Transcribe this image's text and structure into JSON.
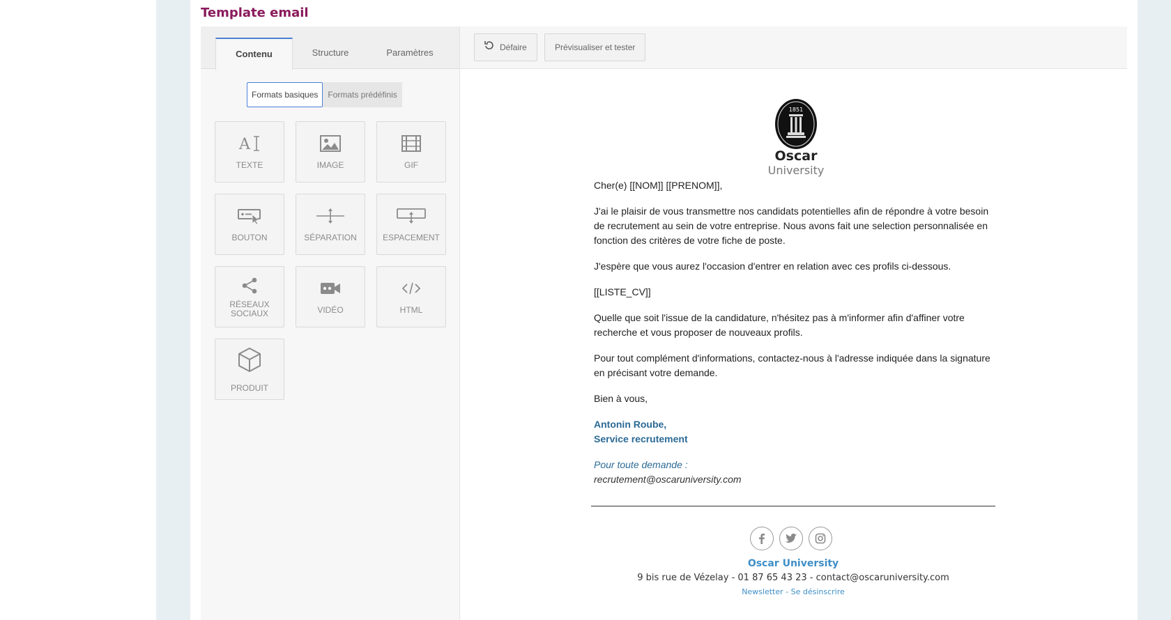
{
  "page": {
    "title": "Template email"
  },
  "tabs": [
    {
      "label": "Contenu",
      "active": true
    },
    {
      "label": "Structure",
      "active": false
    },
    {
      "label": "Paramètres",
      "active": false
    }
  ],
  "formats": {
    "basic": "Formats basiques",
    "predefined": "Formats prédéfinis"
  },
  "blocks": [
    {
      "label": "TEXTE",
      "icon": "text-cursor-icon"
    },
    {
      "label": "IMAGE",
      "icon": "image-icon"
    },
    {
      "label": "GIF",
      "icon": "film-icon"
    },
    {
      "label": "BOUTON",
      "icon": "button-click-icon"
    },
    {
      "label": "SÉPARATION",
      "icon": "divider-icon"
    },
    {
      "label": "ESPACEMENT",
      "icon": "spacing-icon"
    },
    {
      "label": "RÉSEAUX",
      "label2": "SOCIAUX",
      "icon": "share-icon"
    },
    {
      "label": "VIDÉO",
      "icon": "video-camera-icon"
    },
    {
      "label": "HTML",
      "icon": "code-icon"
    },
    {
      "label": "PRODUIT",
      "icon": "cube-icon"
    }
  ],
  "toolbar": {
    "undo": "Défaire",
    "preview": "Prévisualiser et tester"
  },
  "email": {
    "logo": {
      "year": "1851",
      "name": "Oscar",
      "sub": "University"
    },
    "greeting": "Cher(e) [[NOM]] [[PRENOM]],",
    "p1": "J'ai le plaisir de vous transmettre nos candidats potentielles afin de répondre à votre besoin de recrutement au sein de votre entreprise. Nous avons fait une selection personnalisée en fonction des critères de votre fiche de poste.",
    "p2": "J'espère que vous aurez l'occasion d'entrer en relation avec ces profils ci-dessous.",
    "p3": "[[LISTE_CV]]",
    "p4": "Quelle que soit l'issue de la candidature, n'hésitez pas à m'informer afin d'affiner votre recherche et vous proposer de nouveaux profils.",
    "p5": "Pour tout complément d'informations, contactez-nous à l'adresse indiquée dans la signature en précisant votre demande.",
    "closing": "Bien à vous,",
    "sig_name": "Antonin Roube,",
    "sig_service": "Service recrutement",
    "sig_request": "Pour toute demande :",
    "sig_email": "recrutement@oscaruniversity.com"
  },
  "footer": {
    "social": [
      "facebook-icon",
      "twitter-icon",
      "instagram-icon"
    ],
    "name": "Oscar University",
    "address": "9 bis rue de Vézelay - 01 87 65 43 23 - contact@oscaruniversity.com",
    "newsletter": "Newsletter",
    "sep": " - ",
    "unsubscribe": "Se désinscrire"
  }
}
